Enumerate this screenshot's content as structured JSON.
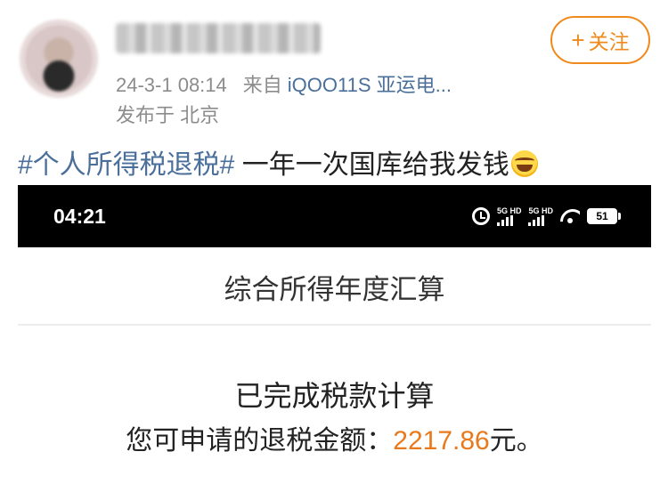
{
  "post": {
    "timestamp": "24-3-1 08:14",
    "from_label": "来自",
    "device": "iQOO11S 亚运电...",
    "location": "发布于 北京",
    "follow_button": {
      "plus": "+",
      "label": "关注"
    },
    "hashtag": "#个人所得税退税#",
    "text": " 一年一次国库给我发钱",
    "emoji_icon": "laughing-tears-emoji"
  },
  "screenshot": {
    "status_bar": {
      "time": "04:21",
      "signal_1_label": "5G HD",
      "signal_2_label": "5G HD",
      "battery": "51"
    },
    "title": "综合所得年度汇算",
    "calc_status": "已完成税款计算",
    "refund_prefix": "您可申请的退税金额：",
    "refund_amount": "2217.86",
    "refund_suffix": "元。"
  },
  "colors": {
    "link": "#4a6f9a",
    "accent": "#f08a1c",
    "amount": "#e87a1d",
    "meta": "#8c8c8c"
  }
}
